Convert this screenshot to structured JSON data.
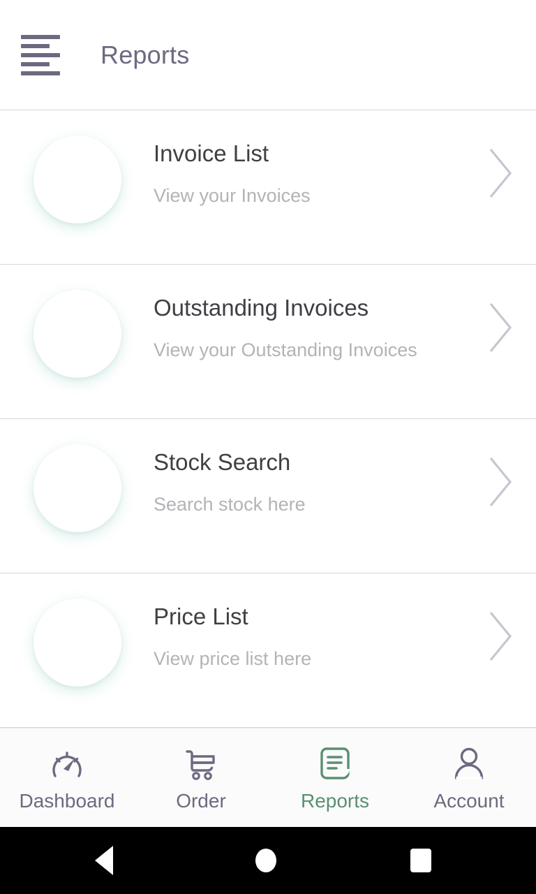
{
  "app": {
    "screen_title": "Reports",
    "menu_icon": "hamburger-menu-icon"
  },
  "reports": {
    "items": [
      {
        "title": "Invoice List",
        "subtitle": "View your Invoices",
        "icon": "documents-stack-icon",
        "chevron": "chevron-right-icon"
      },
      {
        "title": "Outstanding Invoices",
        "subtitle": "View your Outstanding Invoices",
        "icon": "documents-stack-icon",
        "chevron": "chevron-right-icon"
      },
      {
        "title": "Stock Search",
        "subtitle": "Search stock here",
        "icon": "document-search-icon",
        "chevron": "chevron-right-icon"
      },
      {
        "title": "Price List",
        "subtitle": "View price list here",
        "icon": "receipt-rupee-icon",
        "chevron": "chevron-right-icon"
      }
    ]
  },
  "bottom_nav": {
    "items": [
      {
        "label": "Dashboard",
        "icon": "speedometer-icon",
        "active": false
      },
      {
        "label": "Order",
        "icon": "shopping-cart-icon",
        "active": false
      },
      {
        "label": "Reports",
        "icon": "document-lines-icon",
        "active": true
      },
      {
        "label": "Account",
        "icon": "person-icon",
        "active": false
      }
    ]
  },
  "system_bar": {
    "back": "back-triangle-icon",
    "home": "home-circle-icon",
    "recents": "recents-square-icon"
  },
  "colors": {
    "accent_green": "#5b8f72",
    "icon_teal": "#7aa89a",
    "ink": "#3f3f44",
    "muted": "#b3b3b8",
    "nav_purple": "#6b6a80",
    "divider": "#d8d8da"
  }
}
